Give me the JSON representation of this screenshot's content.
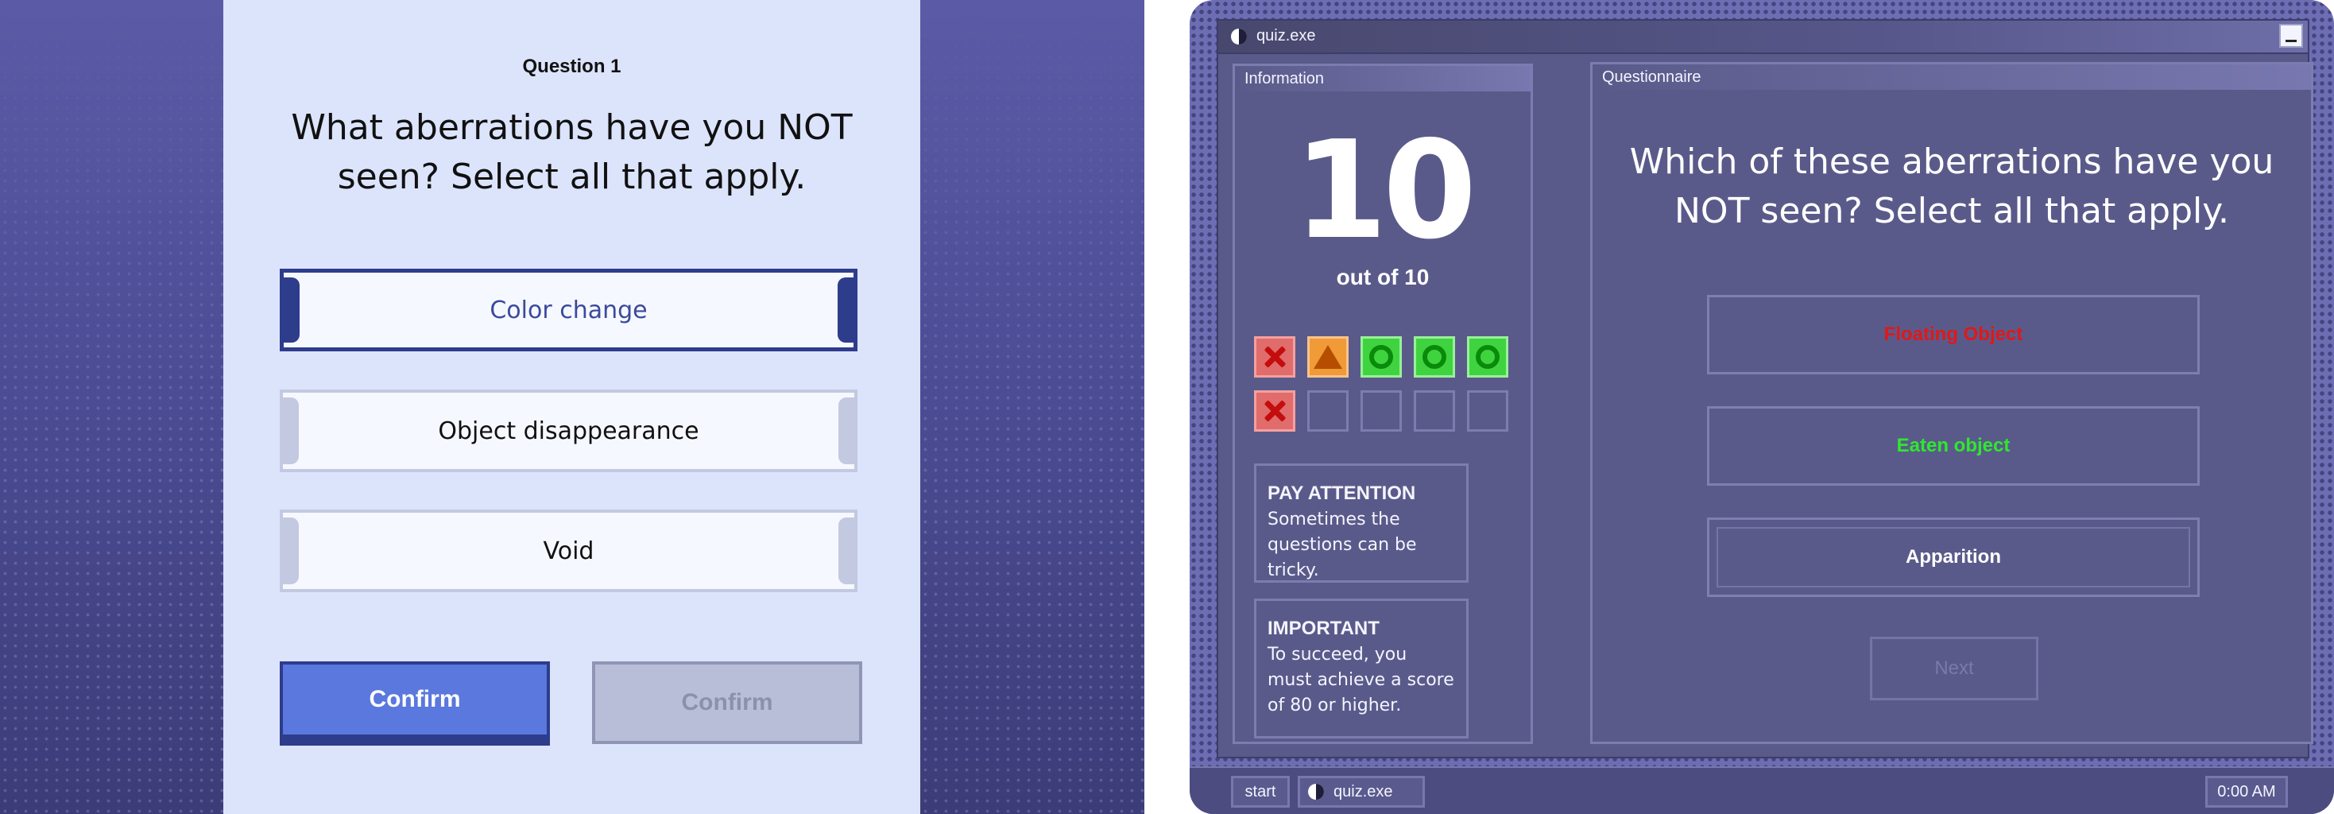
{
  "left_screen": {
    "question_number": "Question 1",
    "question_text": "What aberrations have you NOT seen? Select all that apply.",
    "options": [
      {
        "label": "Color change",
        "selected": true
      },
      {
        "label": "Object disappearance",
        "selected": false
      },
      {
        "label": "Void",
        "selected": false
      }
    ],
    "confirm_active_label": "Confirm",
    "confirm_disabled_label": "Confirm"
  },
  "right_screen": {
    "window_title": "quiz.exe",
    "info_pane_title": "Information",
    "questionnaire_pane_title": "Questionnaire",
    "score": "10",
    "score_total": "out of 10",
    "results": [
      "wrong",
      "warning",
      "correct",
      "correct",
      "correct",
      "wrong",
      "empty",
      "empty",
      "empty",
      "empty"
    ],
    "notes": [
      {
        "heading": "PAY ATTENTION",
        "body": "Sometimes the questions can be tricky."
      },
      {
        "heading": "IMPORTANT",
        "body": "To succeed, you must achieve a score of 80 or higher."
      }
    ],
    "question_text": "Which of these aberrations have you NOT seen? Select all that apply.",
    "options": [
      {
        "label": "Floating Object",
        "color": "#e01818"
      },
      {
        "label": "Eaten object",
        "color": "#2ee82e"
      },
      {
        "label": "Apparition",
        "color": "#ffffff"
      }
    ],
    "next_label": "Next",
    "taskbar": {
      "start_label": "start",
      "task_label": "quiz.exe",
      "clock": "0:00 AM"
    }
  }
}
